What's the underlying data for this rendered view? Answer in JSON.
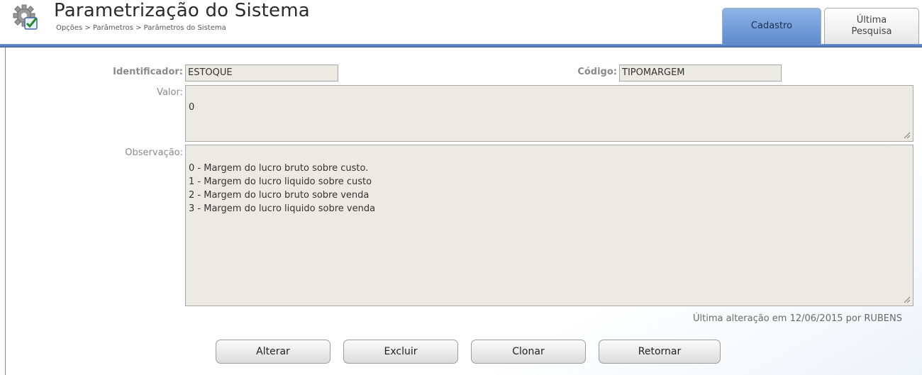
{
  "header": {
    "title": "Parametrização do Sistema",
    "breadcrumb": "Opções > Parâmetros > Parâmetros do Sistema",
    "logo_icon": "gear-checkmark-icon"
  },
  "tabs": [
    {
      "label": "Cadastro",
      "active": true
    },
    {
      "label": "Última\nPesquisa",
      "active": false
    }
  ],
  "form": {
    "identificador_label": "Identificador:",
    "identificador_value": "ESTOQUE",
    "codigo_label": "Código:",
    "codigo_value": "TIPOMARGEM",
    "valor_label": "Valor:",
    "valor_value": "0",
    "observacao_label": "Observação:",
    "observacao_value": "0 - Margem do lucro bruto sobre custo.\n1 - Margem do lucro liquido sobre custo\n2 - Margem do lucro bruto sobre venda\n3 - Margem do lucro liquido sobre venda"
  },
  "last_change": "Última alteração em 12/06/2015 por RUBENS",
  "buttons": {
    "alterar": "Alterar",
    "excluir": "Excluir",
    "clonar": "Clonar",
    "retornar": "Retornar"
  },
  "colors": {
    "accent": "#5d8bcd",
    "field_bg": "#ebebe4"
  }
}
